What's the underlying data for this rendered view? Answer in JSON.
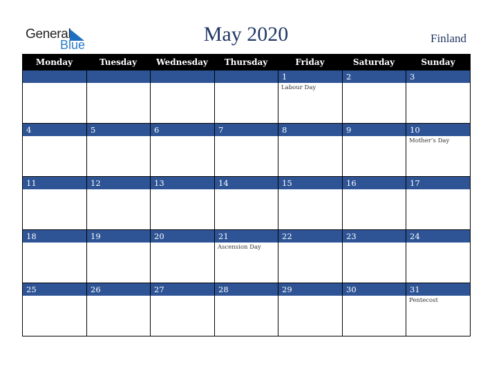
{
  "logo": {
    "line1": "General",
    "line2": "Blue"
  },
  "header": {
    "title": "May 2020",
    "country": "Finland"
  },
  "colors": {
    "header_bg": "#000000",
    "strip_bg": "#2e5496",
    "title": "#203864",
    "logo_blue": "#2a7cc7"
  },
  "weekdays": [
    "Monday",
    "Tuesday",
    "Wednesday",
    "Thursday",
    "Friday",
    "Saturday",
    "Sunday"
  ],
  "weeks": [
    {
      "days": [
        "",
        "",
        "",
        "",
        "1",
        "2",
        "3"
      ],
      "events": [
        "",
        "",
        "",
        "",
        "Labour Day",
        "",
        ""
      ]
    },
    {
      "days": [
        "4",
        "5",
        "6",
        "7",
        "8",
        "9",
        "10"
      ],
      "events": [
        "",
        "",
        "",
        "",
        "",
        "",
        "Mother’s Day"
      ]
    },
    {
      "days": [
        "11",
        "12",
        "13",
        "14",
        "15",
        "16",
        "17"
      ],
      "events": [
        "",
        "",
        "",
        "",
        "",
        "",
        ""
      ]
    },
    {
      "days": [
        "18",
        "19",
        "20",
        "21",
        "22",
        "23",
        "24"
      ],
      "events": [
        "",
        "",
        "",
        "Ascension Day",
        "",
        "",
        ""
      ]
    },
    {
      "days": [
        "25",
        "26",
        "27",
        "28",
        "29",
        "30",
        "31"
      ],
      "events": [
        "",
        "",
        "",
        "",
        "",
        "",
        "Pentecost"
      ]
    }
  ]
}
